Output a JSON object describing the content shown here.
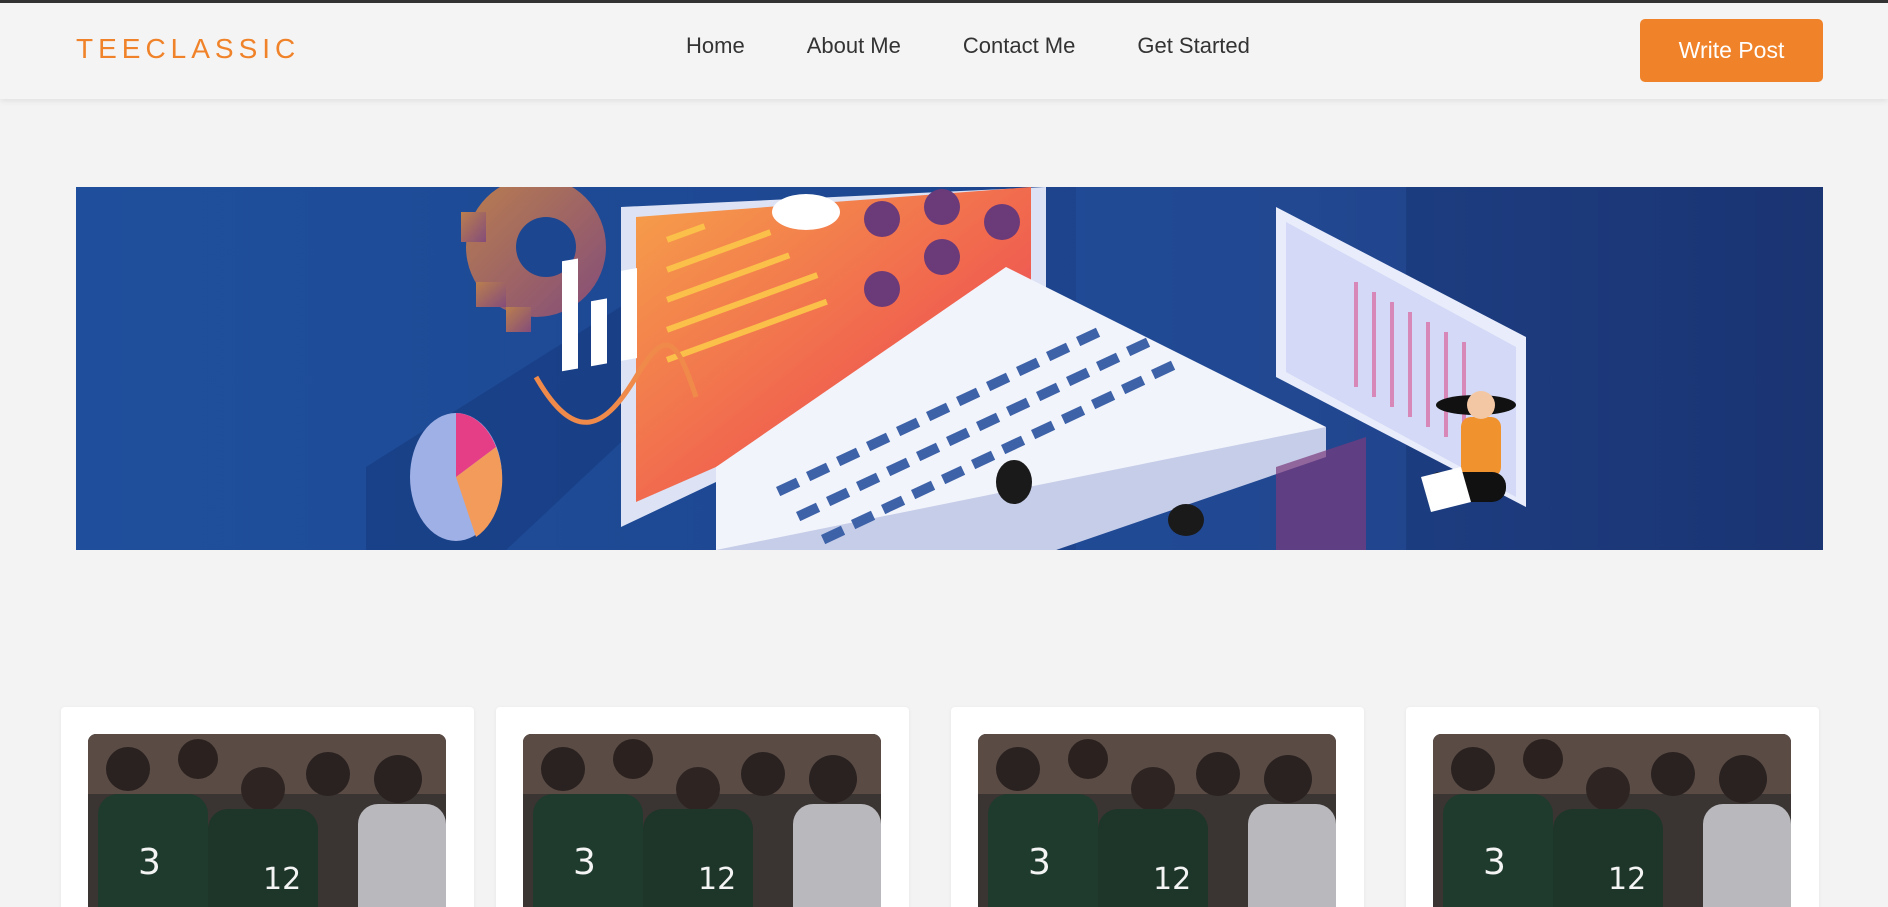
{
  "brand": {
    "logo_text": "TEECLASSIC",
    "accent_color": "#f0832a"
  },
  "nav": {
    "items": [
      {
        "label": "Home"
      },
      {
        "label": "About Me"
      },
      {
        "label": "Contact Me"
      },
      {
        "label": "Get Started"
      }
    ]
  },
  "header": {
    "cta_label": "Write Post"
  },
  "hero": {
    "image_icon": "laptop-analytics-illustration"
  },
  "posts": [
    {
      "image_icon": "team-huddle-photo"
    },
    {
      "image_icon": "team-huddle-photo"
    },
    {
      "image_icon": "team-huddle-photo"
    },
    {
      "image_icon": "team-huddle-photo"
    }
  ]
}
